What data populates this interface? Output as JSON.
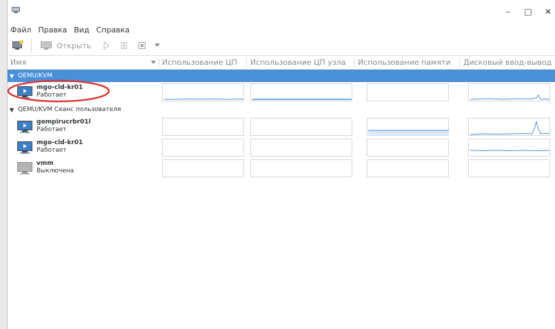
{
  "window": {
    "controls": {
      "minimize": "–",
      "maximize": "□",
      "close": "✕"
    }
  },
  "menu": [
    "Файл",
    "Правка",
    "Вид",
    "Справка"
  ],
  "toolbar": {
    "open_label": "Открыть"
  },
  "columns": {
    "name": "Имя",
    "cpu": "Использование ЦП",
    "host_cpu": "Использование ЦП узла",
    "memory": "Использование памяти",
    "disk_io": "Дисковый ввод-вывод"
  },
  "groups": [
    {
      "label": "QEMU/KVM"
    },
    {
      "label": "QEMU/KVM Сеанс пользователя"
    }
  ],
  "vms": [
    {
      "name": "mgo-cld-kr01",
      "state": "Работает",
      "running": true
    },
    {
      "name": "gompirucrbr01l",
      "state": "Работает",
      "running": true
    },
    {
      "name": "mgo-cld-kr01",
      "state": "Работает",
      "running": true
    },
    {
      "name": "vmm",
      "state": "Выключена",
      "running": false
    }
  ],
  "colors": {
    "selection": "#4a90d9",
    "graph_line": "#4a90d9",
    "annotation": "#d93a3a"
  }
}
